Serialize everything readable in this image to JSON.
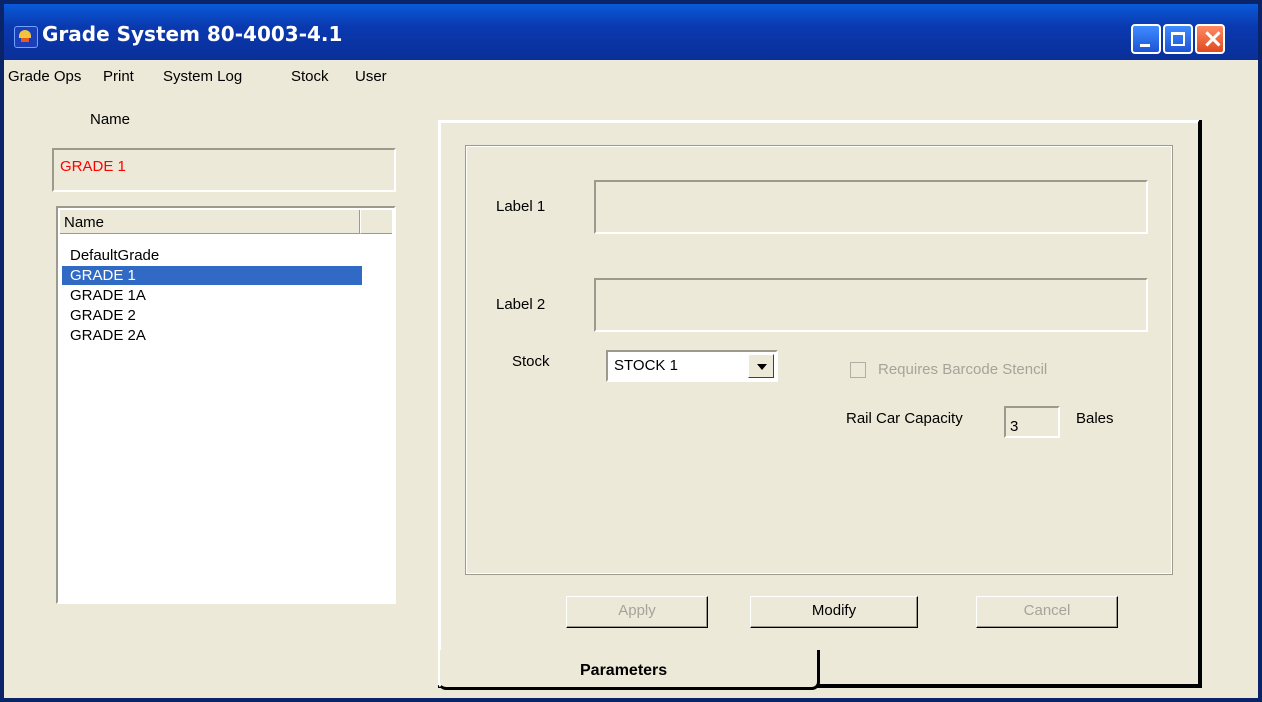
{
  "window": {
    "title": "Grade System 80-4003-4.1"
  },
  "menu": [
    "Grade Ops",
    "Print",
    "System Log",
    "Stock",
    "User"
  ],
  "left": {
    "name_label": "Name",
    "name_value": "GRADE 1",
    "list_header": "Name",
    "items": [
      "DefaultGrade",
      "GRADE 1",
      "GRADE 1A",
      "GRADE 2",
      "GRADE 2A"
    ],
    "selected_index": 1
  },
  "params": {
    "label1": "Label 1",
    "label1_value": "",
    "label2": "Label 2",
    "label2_value": "",
    "stock_label": "Stock",
    "stock_value": "STOCK 1",
    "barcode_label": "Requires Barcode Stencil",
    "capacity_label": "Rail Car Capacity",
    "capacity_value": "3",
    "capacity_unit": "Bales"
  },
  "buttons": {
    "apply": "Apply",
    "modify": "Modify",
    "cancel": "Cancel"
  },
  "tab": {
    "label": "Parameters"
  },
  "colors": {
    "titlebar": "#0a39b0",
    "selection": "#316ac5",
    "name_value": "#ff0000",
    "face": "#ece9d8"
  }
}
